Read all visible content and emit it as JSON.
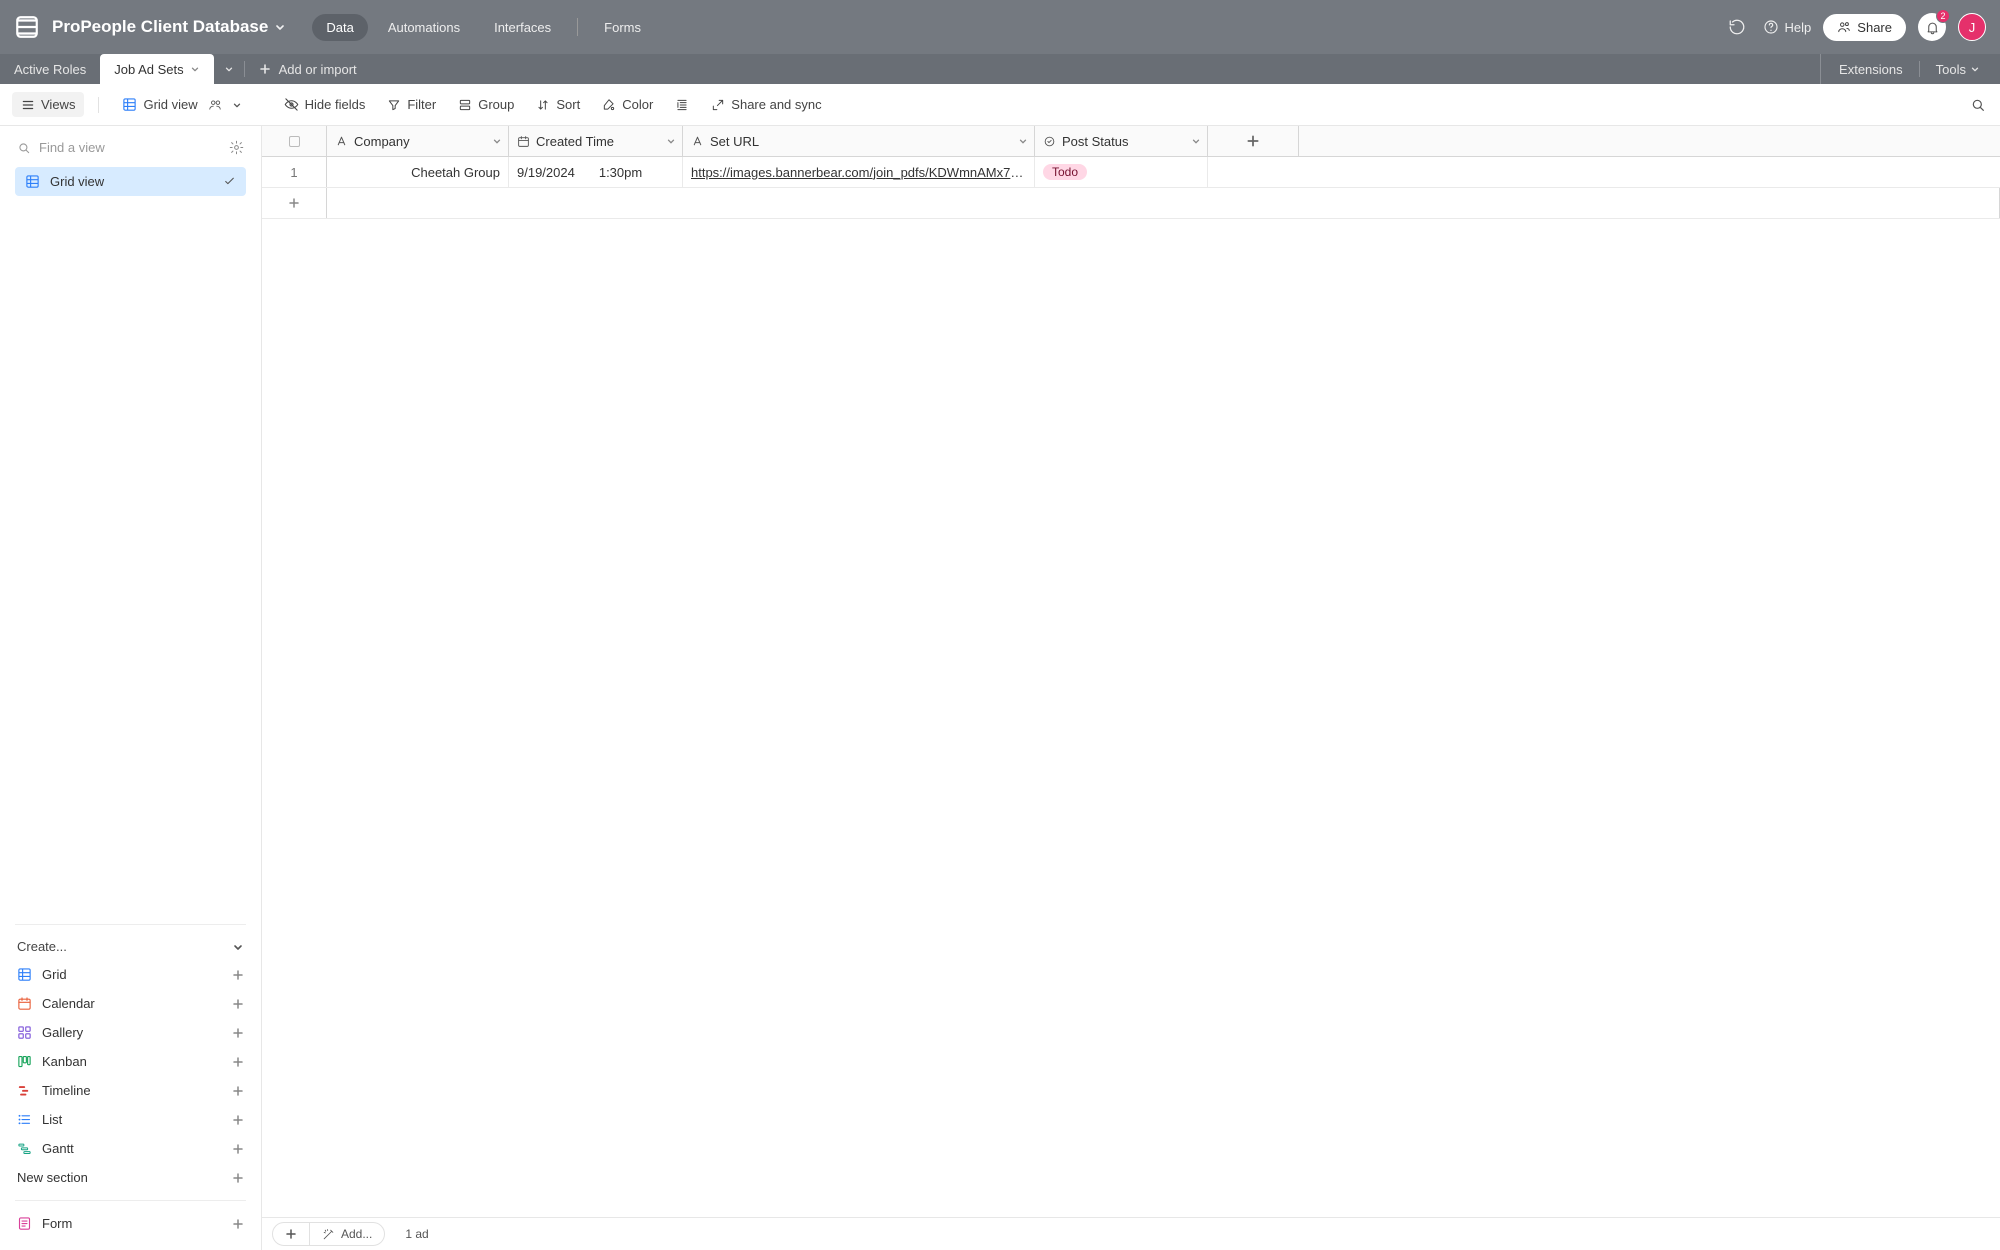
{
  "topbar": {
    "title": "ProPeople Client Database",
    "nav": [
      "Data",
      "Automations",
      "Interfaces",
      "Forms"
    ],
    "active_nav": 0,
    "help": "Help",
    "share": "Share",
    "notification_count": "2",
    "avatar_initial": "J"
  },
  "tabsbar": {
    "tabs": [
      {
        "label": "Active Roles",
        "active": false
      },
      {
        "label": "Job Ad Sets",
        "active": true
      }
    ],
    "add_or_import": "Add or import",
    "extensions": "Extensions",
    "tools": "Tools"
  },
  "toolbar": {
    "views": "Views",
    "grid_view": "Grid view",
    "hide_fields": "Hide fields",
    "filter": "Filter",
    "group": "Group",
    "sort": "Sort",
    "color": "Color",
    "share_sync": "Share and sync"
  },
  "sidebar": {
    "search_placeholder": "Find a view",
    "active_view": "Grid view",
    "create_label": "Create...",
    "create_items": [
      "Grid",
      "Calendar",
      "Gallery",
      "Kanban",
      "Timeline",
      "List",
      "Gantt"
    ],
    "new_section": "New section",
    "form": "Form"
  },
  "grid": {
    "columns": [
      "Company",
      "Created Time",
      "Set URL",
      "Post Status"
    ],
    "rows": [
      {
        "num": "1",
        "company": "Cheetah Group",
        "created_date": "9/19/2024",
        "created_time": "1:30pm",
        "url": "https://images.bannerbear.com/join_pdfs/KDWmnAMx7A...",
        "status": "Todo"
      }
    ],
    "add_label": "Add...",
    "footer_count": "1 ad"
  }
}
